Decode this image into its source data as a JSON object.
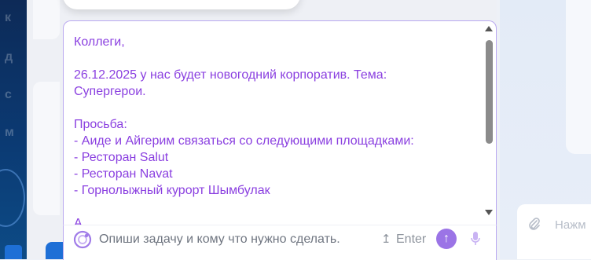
{
  "editor": {
    "message": "Коллеги,\n\n26.12.2025 у нас будет новогодний корпоратив. Тема:\nСупергерои.\n\nПросьба:\n- Аиде и Айгерим связаться со следующими площадками:\n- Ресторан Salut\n- Ресторан Navat\n- Горнолыжный курорт Шымбулак\n\nА"
  },
  "composer": {
    "placeholder": "Опиши задачу и кому что нужно сделать.",
    "enter_icon": "↥",
    "enter_label": "Enter",
    "send_icon": "↑"
  },
  "right_panel": {
    "input_placeholder": "Нажм",
    "clip_icon": "paperclip-icon"
  },
  "colors": {
    "accent": "#9b74e6",
    "text_accent": "#8a3fe0",
    "sidebar": "#0d2a57",
    "blue": "#1e6fd6"
  }
}
